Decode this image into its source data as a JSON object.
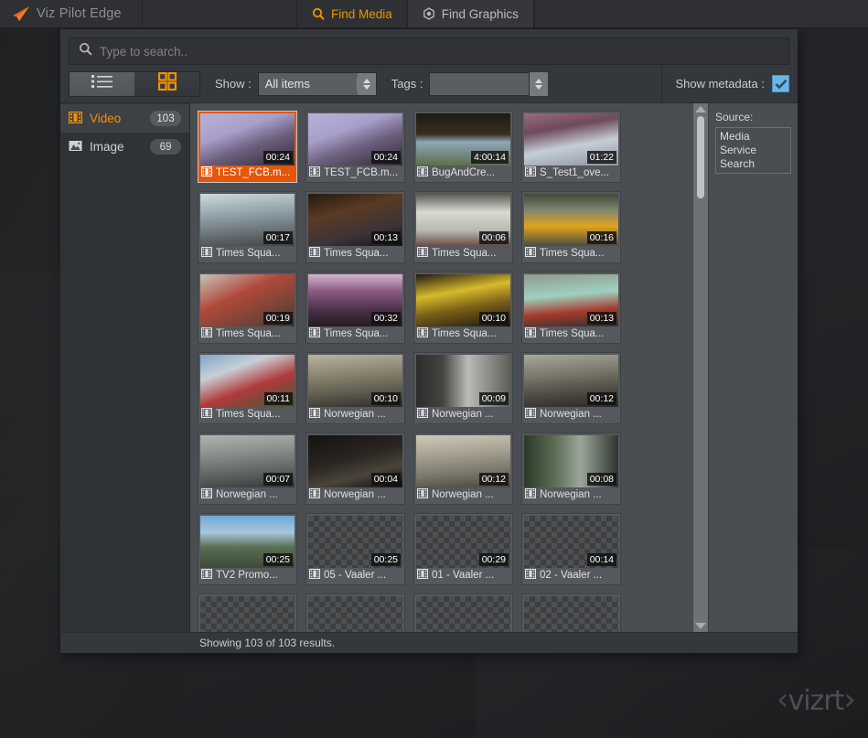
{
  "app": {
    "brand_name": "Viz Pilot Edge",
    "logo_icon": "arrow-logo-icon"
  },
  "tabs": [
    {
      "label": "Find Media",
      "icon": "search-icon",
      "active": true
    },
    {
      "label": "Find Graphics",
      "icon": "graphics-icon",
      "active": false
    }
  ],
  "search": {
    "placeholder": "Type to search..",
    "value": "",
    "icon": "search-icon"
  },
  "toolbar": {
    "view_list_icon": "list-view-icon",
    "view_grid_icon": "grid-view-icon",
    "show_label": "Show :",
    "show_value": "All items",
    "tags_label": "Tags :",
    "tags_value": "",
    "metadata_label": "Show metadata :",
    "metadata_checked": true,
    "accent_color": "#f39200",
    "selection_color": "#e4560b",
    "checkbox_color": "#6ab6e8"
  },
  "sidebar": {
    "items": [
      {
        "label": "Video",
        "count": "103",
        "icon": "film-icon",
        "active": true
      },
      {
        "label": "Image",
        "count": "69",
        "icon": "picture-icon",
        "active": false
      }
    ]
  },
  "grid": {
    "items": [
      {
        "title": "TEST_FCB.m...",
        "duration": "00:24",
        "selected": true,
        "thumb": "interview-purple",
        "placeholder": false
      },
      {
        "title": "TEST_FCB.m...",
        "duration": "00:24",
        "selected": false,
        "thumb": "interview-purple",
        "placeholder": false
      },
      {
        "title": "BugAndCre...",
        "duration": "4:00:14",
        "selected": false,
        "thumb": "reporter-field",
        "placeholder": false
      },
      {
        "title": "S_Test1_ove...",
        "duration": "01:22",
        "selected": false,
        "thumb": "skating-arena",
        "placeholder": false
      },
      {
        "title": "Times Squa...",
        "duration": "00:17",
        "selected": false,
        "thumb": "times-square-day",
        "placeholder": false
      },
      {
        "title": "Times Squa...",
        "duration": "00:13",
        "selected": false,
        "thumb": "crowd-night",
        "placeholder": false
      },
      {
        "title": "Times Squa...",
        "duration": "00:06",
        "selected": false,
        "thumb": "white-truck",
        "placeholder": false
      },
      {
        "title": "Times Squa...",
        "duration": "00:16",
        "selected": false,
        "thumb": "yellow-taxis",
        "placeholder": false
      },
      {
        "title": "Times Squa...",
        "duration": "00:19",
        "selected": false,
        "thumb": "red-jacket-hands",
        "placeholder": false
      },
      {
        "title": "Times Squa...",
        "duration": "00:32",
        "selected": false,
        "thumb": "crowd-pink-lights",
        "placeholder": false
      },
      {
        "title": "Times Squa...",
        "duration": "00:10",
        "selected": false,
        "thumb": "billboards-night",
        "placeholder": false
      },
      {
        "title": "Times Squa...",
        "duration": "00:13",
        "selected": false,
        "thumb": "statue-liberty-busker",
        "placeholder": false
      },
      {
        "title": "Times Squa...",
        "duration": "00:11",
        "selected": false,
        "thumb": "american-flags",
        "placeholder": false
      },
      {
        "title": "Norwegian ...",
        "duration": "00:10",
        "selected": false,
        "thumb": "train-platform",
        "placeholder": false
      },
      {
        "title": "Norwegian ...",
        "duration": "00:09",
        "selected": false,
        "thumb": "train-arriving",
        "placeholder": false
      },
      {
        "title": "Norwegian ...",
        "duration": "00:12",
        "selected": false,
        "thumb": "passengers-boarding",
        "placeholder": false
      },
      {
        "title": "Norwegian ...",
        "duration": "00:07",
        "selected": false,
        "thumb": "train-front",
        "placeholder": false
      },
      {
        "title": "Norwegian ...",
        "duration": "00:04",
        "selected": false,
        "thumb": "cab-interior-dark",
        "placeholder": false
      },
      {
        "title": "Norwegian ...",
        "duration": "00:12",
        "selected": false,
        "thumb": "station-concourse",
        "placeholder": false
      },
      {
        "title": "Norwegian ...",
        "duration": "00:08",
        "selected": false,
        "thumb": "train-tunnel",
        "placeholder": false
      },
      {
        "title": "TV2 Promo...",
        "duration": "00:25",
        "selected": false,
        "thumb": "mountain-vista",
        "placeholder": false
      },
      {
        "title": "05 - Vaaler ...",
        "duration": "00:25",
        "selected": false,
        "thumb": "",
        "placeholder": true
      },
      {
        "title": "01 - Vaaler ...",
        "duration": "00:29",
        "selected": false,
        "thumb": "",
        "placeholder": true
      },
      {
        "title": "02 - Vaaler ...",
        "duration": "00:14",
        "selected": false,
        "thumb": "",
        "placeholder": true
      },
      {
        "title": "",
        "duration": "",
        "selected": false,
        "thumb": "",
        "placeholder": true
      },
      {
        "title": "",
        "duration": "",
        "selected": false,
        "thumb": "",
        "placeholder": true
      },
      {
        "title": "",
        "duration": "",
        "selected": false,
        "thumb": "",
        "placeholder": true
      },
      {
        "title": "",
        "duration": "",
        "selected": false,
        "thumb": "",
        "placeholder": true
      }
    ]
  },
  "metadata_panel": {
    "source_label": "Source:",
    "source_value": "Media Service Search"
  },
  "statusbar": {
    "text": "Showing 103 of 103 results."
  },
  "watermark": {
    "text": "vizrt"
  }
}
